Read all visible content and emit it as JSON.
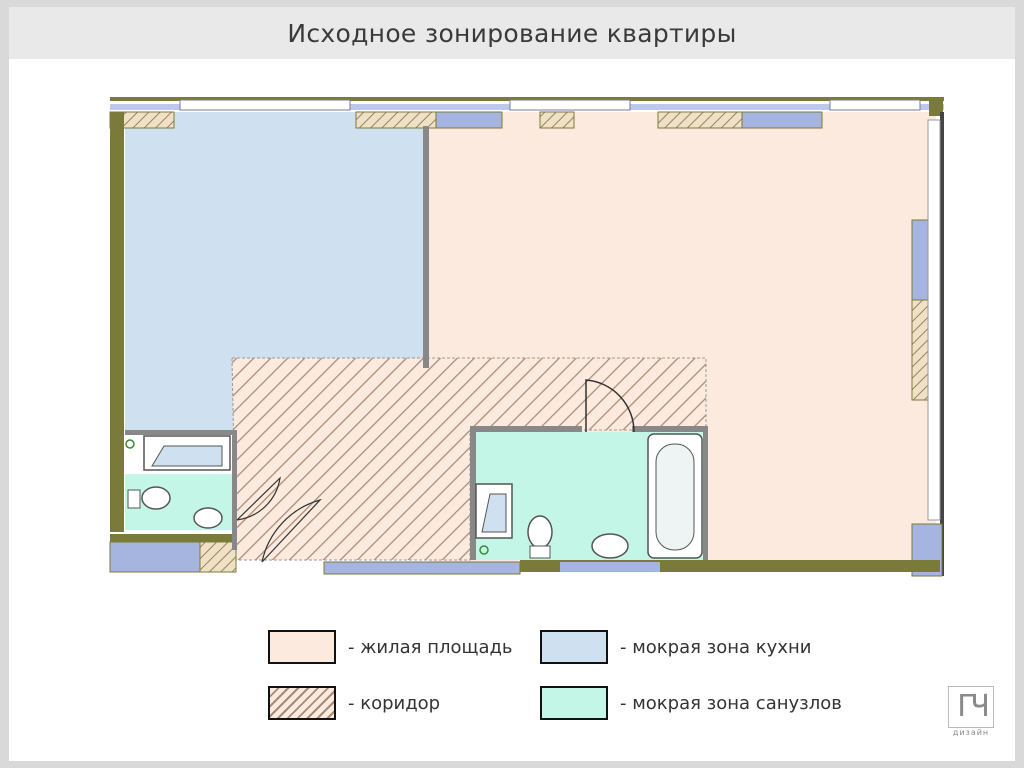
{
  "title": "Исходное зонирование квартиры",
  "legend": [
    {
      "label": "- жилая площадь",
      "zone": "living",
      "color": "#fbeadd"
    },
    {
      "label": "- коридор",
      "zone": "corridor",
      "color": "#fbeadd",
      "pattern": "hatched"
    },
    {
      "label": "- мокрая зона кухни",
      "zone": "kitchen",
      "color": "#cfe1f0"
    },
    {
      "label": "- мокрая зона санузлов",
      "zone": "bath",
      "color": "#c3f6e6"
    }
  ],
  "logo": {
    "mark": "ГЧ",
    "caption": "дизайн"
  },
  "colors": {
    "wall": "#7a7a3a",
    "window": "#a6b5e0",
    "living": "#fbeadd",
    "kitchen": "#cfe1f0",
    "bath": "#c3f6e6",
    "hatch": "#a88a78"
  }
}
